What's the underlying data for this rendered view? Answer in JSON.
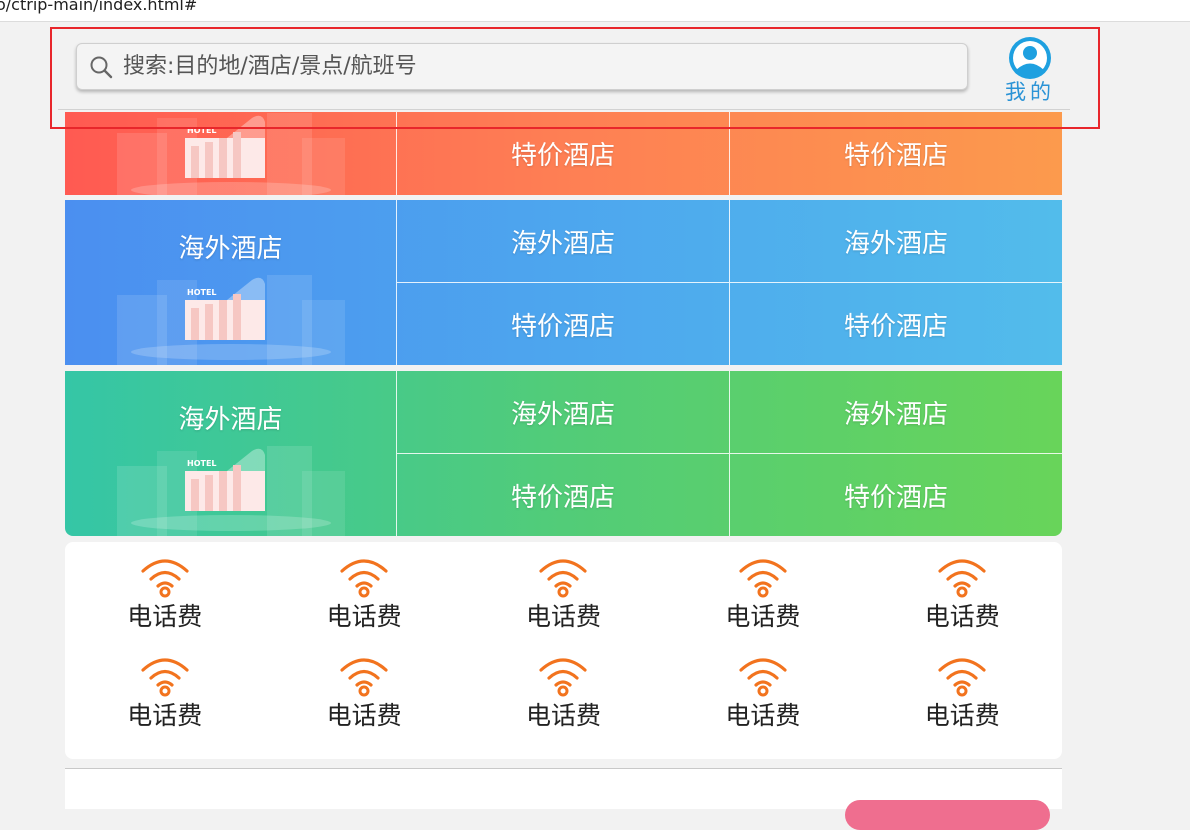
{
  "browser": {
    "url": "o/ctrip-main/index.html#"
  },
  "header": {
    "search": {
      "placeholder": "搜索:目的地/酒店/景点/航班号",
      "icon": "search-icon"
    },
    "mine": {
      "label": "我的",
      "icon": "user-avatar-icon",
      "color": "#2a93d6"
    }
  },
  "hotel_rows": [
    {
      "theme": "red",
      "big_label": "",
      "cells": [
        "特价酒店",
        "特价酒店"
      ]
    },
    {
      "theme": "blue",
      "big_label": "海外酒店",
      "cells": [
        "海外酒店",
        "特价酒店",
        "海外酒店",
        "特价酒店"
      ]
    },
    {
      "theme": "green",
      "big_label": "海外酒店",
      "cells": [
        "海外酒店",
        "特价酒店",
        "海外酒店",
        "特价酒店"
      ]
    }
  ],
  "hotel_illustration_text": "HOTEL",
  "services": {
    "icon": "wifi-icon",
    "icon_color": "#f2731e",
    "items": [
      "电话费",
      "电话费",
      "电话费",
      "电话费",
      "电话费",
      "电话费",
      "电话费",
      "电话费",
      "电话费",
      "电话费"
    ]
  },
  "colors": {
    "red_row": [
      "#ff5a52",
      "#fc9a4d"
    ],
    "blue_row": [
      "#4b8ff0",
      "#52bceb"
    ],
    "green_row": [
      "#35c6a6",
      "#68d45a"
    ],
    "highlight_box": "#e8262b"
  }
}
